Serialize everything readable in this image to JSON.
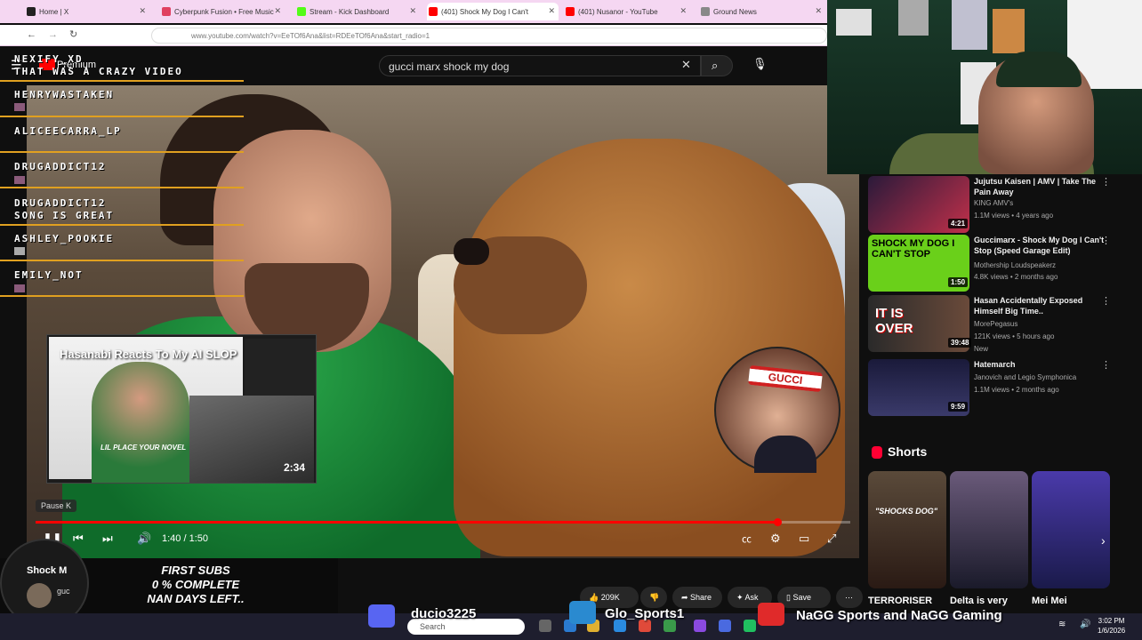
{
  "browser": {
    "tabs": [
      {
        "label": "Home | X",
        "color": "#222"
      },
      {
        "label": "Cyberpunk Fusion • Free Music",
        "color": "#e04060"
      },
      {
        "label": "Stream - Kick Dashboard",
        "color": "#53fc18"
      },
      {
        "label": "(401) Shock My Dog I Can't",
        "color": "#ff0000"
      },
      {
        "label": "(401) Nusanor - YouTube",
        "color": "#ff0000"
      },
      {
        "label": "Ground News",
        "color": "#888"
      }
    ],
    "url": "www.youtube.com/watch?v=EeTOf6Ana&list=RDEeTOf6Ana&start_radio=1"
  },
  "youtube": {
    "logo_text": "Premium",
    "search_value": "gucci marx shock my dog"
  },
  "chat": [
    {
      "user": "NEXIFY_XD",
      "message": "THAT WAS A CRAZY VIDEO"
    },
    {
      "user": "HENRYWASTAKEN",
      "message": ""
    },
    {
      "user": "ALICEECARRA_LP",
      "message": ""
    },
    {
      "user": "DRUGADDICT12",
      "message": ""
    },
    {
      "user": "DRUGADDICT12",
      "message": "SONG IS GREAT"
    },
    {
      "user": "ASHLEY_POOKIE",
      "message": ""
    },
    {
      "user": "EMILY_NOT",
      "message": ""
    }
  ],
  "inset": {
    "title": "Hasanabi Reacts To My AI SLOP",
    "duration": "2:34",
    "caption": "LIL PLACE YOUR NOVEL"
  },
  "circle_cam": {
    "headband_text": "GUCCI"
  },
  "player": {
    "pause_tooltip": "Pause  K",
    "timecode": "1:40 / 1:50",
    "progress": 0.91
  },
  "sidebar": {
    "recs": [
      {
        "title": "Jujutsu Kaisen | AMV | Take The Pain Away",
        "channel": "KING AMV's",
        "meta": "1.1M views • 4 years ago",
        "duration": "4:21",
        "new": ""
      },
      {
        "title": "Guccimarx - Shock My Dog I Can't Stop (Speed Garage Edit)",
        "channel": "Mothership Loudspeakerz",
        "meta": "4.8K views • 2 months ago",
        "duration": "1:50",
        "new": ""
      },
      {
        "title": "Hasan Accidentally Exposed Himself Big Time..",
        "channel": "MorePegasus",
        "meta": "121K views • 5 hours ago",
        "duration": "39:48",
        "new": "New"
      },
      {
        "title": "Hatemarch",
        "channel": "Janovich and Legio Symphonica",
        "meta": "1.1M views • 2 months ago",
        "duration": "9:59",
        "new": ""
      }
    ],
    "thumb_text": [
      "SHOCK MY DOG I CAN'T STOP",
      "IT IS OVER"
    ],
    "shorts_title": "Shorts",
    "shorts": [
      {
        "label": "TERRORISER",
        "overlay": "\"SHOCKS DOG\""
      },
      {
        "label": "Delta is very",
        "overlay": ""
      },
      {
        "label": "Mei Mei",
        "overlay": ""
      }
    ]
  },
  "actions": {
    "likes": "209K",
    "share": "Share",
    "ask": "Ask",
    "save": "Save"
  },
  "stream_overlay": {
    "subs_goal_line1": "FIRST SUBS",
    "subs_goal_line2": "0 % COMPLETE",
    "subs_goal_line3": "NAN DAYS LEFT..",
    "mini_title": "Shock M",
    "mini_sub": "guc"
  },
  "socials": [
    {
      "name": "ducio3225"
    },
    {
      "name": "Glo_Sports1"
    },
    {
      "name": "NaGG Sports and NaGG Gaming"
    }
  ],
  "taskbar": {
    "search_placeholder": "Search",
    "time": "3:02 PM",
    "date": "1/6/2026"
  }
}
